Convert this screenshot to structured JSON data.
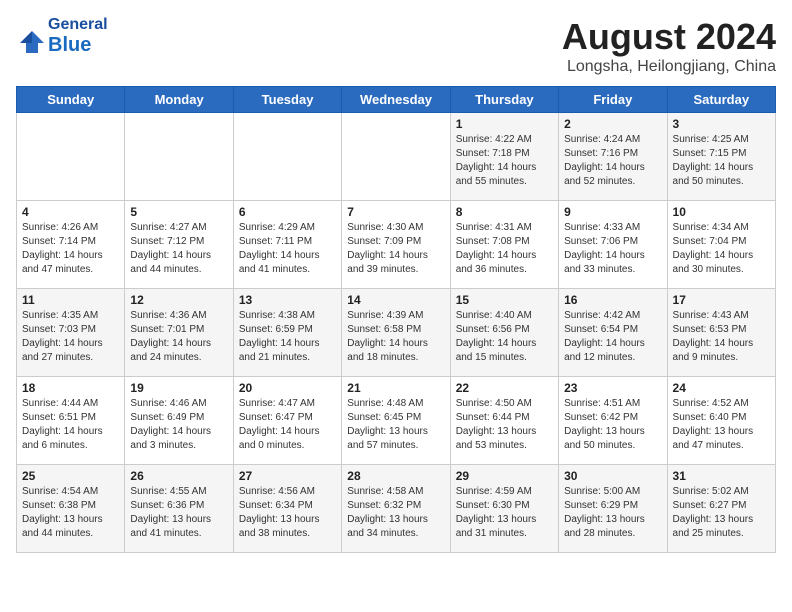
{
  "header": {
    "logo_general": "General",
    "logo_blue": "Blue",
    "month_title": "August 2024",
    "location": "Longsha, Heilongjiang, China"
  },
  "weekdays": [
    "Sunday",
    "Monday",
    "Tuesday",
    "Wednesday",
    "Thursday",
    "Friday",
    "Saturday"
  ],
  "weeks": [
    [
      {
        "day": "",
        "info": ""
      },
      {
        "day": "",
        "info": ""
      },
      {
        "day": "",
        "info": ""
      },
      {
        "day": "",
        "info": ""
      },
      {
        "day": "1",
        "info": "Sunrise: 4:22 AM\nSunset: 7:18 PM\nDaylight: 14 hours\nand 55 minutes."
      },
      {
        "day": "2",
        "info": "Sunrise: 4:24 AM\nSunset: 7:16 PM\nDaylight: 14 hours\nand 52 minutes."
      },
      {
        "day": "3",
        "info": "Sunrise: 4:25 AM\nSunset: 7:15 PM\nDaylight: 14 hours\nand 50 minutes."
      }
    ],
    [
      {
        "day": "4",
        "info": "Sunrise: 4:26 AM\nSunset: 7:14 PM\nDaylight: 14 hours\nand 47 minutes."
      },
      {
        "day": "5",
        "info": "Sunrise: 4:27 AM\nSunset: 7:12 PM\nDaylight: 14 hours\nand 44 minutes."
      },
      {
        "day": "6",
        "info": "Sunrise: 4:29 AM\nSunset: 7:11 PM\nDaylight: 14 hours\nand 41 minutes."
      },
      {
        "day": "7",
        "info": "Sunrise: 4:30 AM\nSunset: 7:09 PM\nDaylight: 14 hours\nand 39 minutes."
      },
      {
        "day": "8",
        "info": "Sunrise: 4:31 AM\nSunset: 7:08 PM\nDaylight: 14 hours\nand 36 minutes."
      },
      {
        "day": "9",
        "info": "Sunrise: 4:33 AM\nSunset: 7:06 PM\nDaylight: 14 hours\nand 33 minutes."
      },
      {
        "day": "10",
        "info": "Sunrise: 4:34 AM\nSunset: 7:04 PM\nDaylight: 14 hours\nand 30 minutes."
      }
    ],
    [
      {
        "day": "11",
        "info": "Sunrise: 4:35 AM\nSunset: 7:03 PM\nDaylight: 14 hours\nand 27 minutes."
      },
      {
        "day": "12",
        "info": "Sunrise: 4:36 AM\nSunset: 7:01 PM\nDaylight: 14 hours\nand 24 minutes."
      },
      {
        "day": "13",
        "info": "Sunrise: 4:38 AM\nSunset: 6:59 PM\nDaylight: 14 hours\nand 21 minutes."
      },
      {
        "day": "14",
        "info": "Sunrise: 4:39 AM\nSunset: 6:58 PM\nDaylight: 14 hours\nand 18 minutes."
      },
      {
        "day": "15",
        "info": "Sunrise: 4:40 AM\nSunset: 6:56 PM\nDaylight: 14 hours\nand 15 minutes."
      },
      {
        "day": "16",
        "info": "Sunrise: 4:42 AM\nSunset: 6:54 PM\nDaylight: 14 hours\nand 12 minutes."
      },
      {
        "day": "17",
        "info": "Sunrise: 4:43 AM\nSunset: 6:53 PM\nDaylight: 14 hours\nand 9 minutes."
      }
    ],
    [
      {
        "day": "18",
        "info": "Sunrise: 4:44 AM\nSunset: 6:51 PM\nDaylight: 14 hours\nand 6 minutes."
      },
      {
        "day": "19",
        "info": "Sunrise: 4:46 AM\nSunset: 6:49 PM\nDaylight: 14 hours\nand 3 minutes."
      },
      {
        "day": "20",
        "info": "Sunrise: 4:47 AM\nSunset: 6:47 PM\nDaylight: 14 hours\nand 0 minutes."
      },
      {
        "day": "21",
        "info": "Sunrise: 4:48 AM\nSunset: 6:45 PM\nDaylight: 13 hours\nand 57 minutes."
      },
      {
        "day": "22",
        "info": "Sunrise: 4:50 AM\nSunset: 6:44 PM\nDaylight: 13 hours\nand 53 minutes."
      },
      {
        "day": "23",
        "info": "Sunrise: 4:51 AM\nSunset: 6:42 PM\nDaylight: 13 hours\nand 50 minutes."
      },
      {
        "day": "24",
        "info": "Sunrise: 4:52 AM\nSunset: 6:40 PM\nDaylight: 13 hours\nand 47 minutes."
      }
    ],
    [
      {
        "day": "25",
        "info": "Sunrise: 4:54 AM\nSunset: 6:38 PM\nDaylight: 13 hours\nand 44 minutes."
      },
      {
        "day": "26",
        "info": "Sunrise: 4:55 AM\nSunset: 6:36 PM\nDaylight: 13 hours\nand 41 minutes."
      },
      {
        "day": "27",
        "info": "Sunrise: 4:56 AM\nSunset: 6:34 PM\nDaylight: 13 hours\nand 38 minutes."
      },
      {
        "day": "28",
        "info": "Sunrise: 4:58 AM\nSunset: 6:32 PM\nDaylight: 13 hours\nand 34 minutes."
      },
      {
        "day": "29",
        "info": "Sunrise: 4:59 AM\nSunset: 6:30 PM\nDaylight: 13 hours\nand 31 minutes."
      },
      {
        "day": "30",
        "info": "Sunrise: 5:00 AM\nSunset: 6:29 PM\nDaylight: 13 hours\nand 28 minutes."
      },
      {
        "day": "31",
        "info": "Sunrise: 5:02 AM\nSunset: 6:27 PM\nDaylight: 13 hours\nand 25 minutes."
      }
    ]
  ]
}
